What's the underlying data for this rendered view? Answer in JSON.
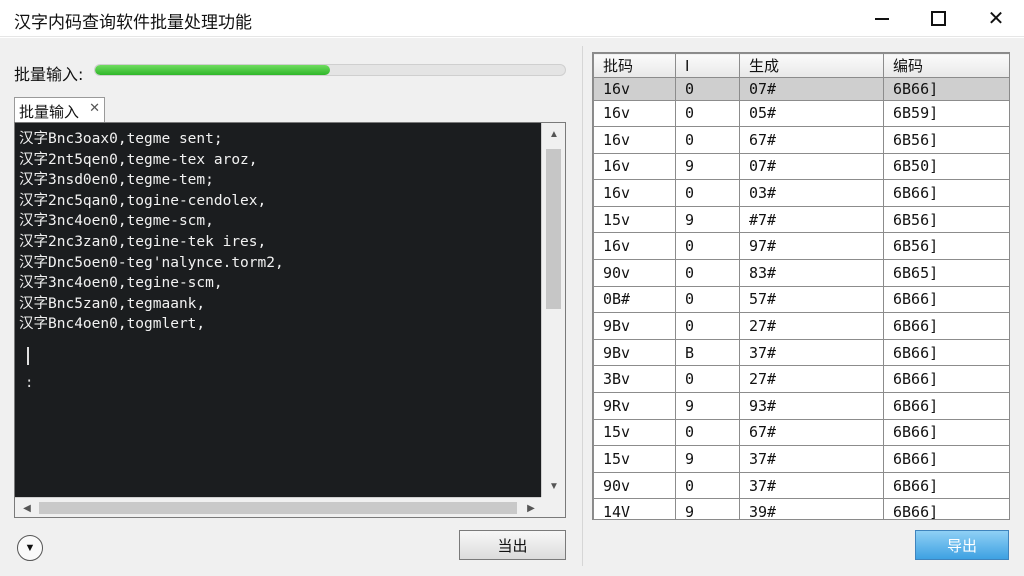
{
  "window": {
    "title": "汉字内码查询软件批量处理功能",
    "minimize_icon": "minimize-icon",
    "maximize_icon": "maximize-icon",
    "close_icon": "close-icon",
    "close_glyph": "✕"
  },
  "batch": {
    "label": "批量输入:",
    "progress_percent": 50,
    "progress_color": "#3cc235"
  },
  "tab": {
    "label": "批量输入",
    "close_glyph": "✕"
  },
  "console": {
    "lines": [
      "汉字Bnc3oax0,tegme sent;",
      "汉字2nt5qen0,tegme-tex aroz,",
      "汉字3nsd0en0,tegme-tem;",
      "汉字2nc5qan0,togine-cendolex,",
      "汉字3nc4oen0,tegme-scm,",
      "汉字2nc3zan0,tegine-tek ires,",
      "汉字Dnc5oen0-teg'nalynce.torm2,",
      "汉字3nc4oen0,tegine-scm,",
      "汉字Bnc5zan0,tegmaank,",
      "汉字Bnc4oen0,togmlert,"
    ],
    "colon": ":",
    "scroll_up": "▲",
    "scroll_down": "▼",
    "scroll_left": "◀",
    "scroll_right": "▶"
  },
  "buttons": {
    "expand_glyph": "▼",
    "export_left": "当出",
    "export_right": "导出"
  },
  "table": {
    "headers": [
      "批码",
      "I",
      "生成",
      "编码"
    ],
    "rows": [
      [
        "16v",
        "0",
        "07#",
        "6B66]"
      ],
      [
        "16v",
        "0",
        "05#",
        "6B59]"
      ],
      [
        "16v",
        "0",
        "67#",
        "6B56]"
      ],
      [
        "16v",
        "9",
        "07#",
        "6B50]"
      ],
      [
        "16v",
        "0",
        "03#",
        "6B66]"
      ],
      [
        "15v",
        "9",
        "#7#",
        "6B56]"
      ],
      [
        "16v",
        "0",
        "97#",
        "6B56]"
      ],
      [
        "90v",
        "0",
        "83#",
        "6B65]"
      ],
      [
        "0B#",
        "0",
        "57#",
        "6B66]"
      ],
      [
        "9Bv",
        "0",
        "27#",
        "6B66]"
      ],
      [
        "9Bv",
        "B",
        "37#",
        "6B66]"
      ],
      [
        "3Bv",
        "0",
        "27#",
        "6B66]"
      ],
      [
        "9Rv",
        "9",
        "93#",
        "6B66]"
      ],
      [
        "15v",
        "0",
        "67#",
        "6B66]"
      ],
      [
        "15v",
        "9",
        "37#",
        "6B66]"
      ],
      [
        "90v",
        "0",
        "37#",
        "6B66]"
      ],
      [
        "14V",
        "9",
        "39#",
        "6B66]"
      ]
    ],
    "selected_row": 0
  }
}
